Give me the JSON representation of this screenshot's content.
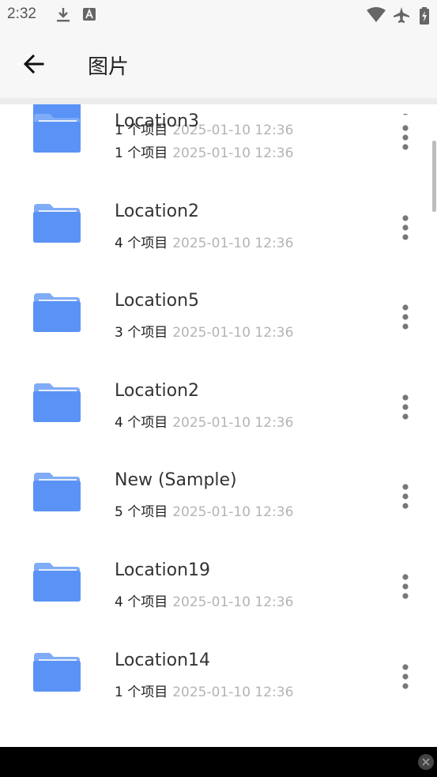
{
  "status_bar": {
    "time": "2:32",
    "icons": [
      "download-icon",
      "a-badge-icon",
      "wifi-icon",
      "airplane-icon",
      "battery-icon"
    ]
  },
  "app_bar": {
    "back_icon": "arrow-left-icon",
    "title": "图片"
  },
  "partial_row": {
    "count": "1 个项目",
    "date": "2025-01-10 12:36"
  },
  "folders": [
    {
      "name": "Location3",
      "count": "1 个项目",
      "date": "2025-01-10 12:36"
    },
    {
      "name": "Location2",
      "count": "4 个项目",
      "date": "2025-01-10 12:36"
    },
    {
      "name": "Location5",
      "count": "3 个项目",
      "date": "2025-01-10 12:36"
    },
    {
      "name": "Location2",
      "count": "4 个项目",
      "date": "2025-01-10 12:36"
    },
    {
      "name": "New (Sample)",
      "count": "5 个项目",
      "date": "2025-01-10 12:36"
    },
    {
      "name": "Location19",
      "count": "4 个项目",
      "date": "2025-01-10 12:36"
    },
    {
      "name": "Location14",
      "count": "1 个项目",
      "date": "2025-01-10 12:36"
    }
  ],
  "colors": {
    "folder_blue": "#5a93f5",
    "folder_tab": "#7fabf7",
    "folder_paper": "#e8eef8"
  }
}
